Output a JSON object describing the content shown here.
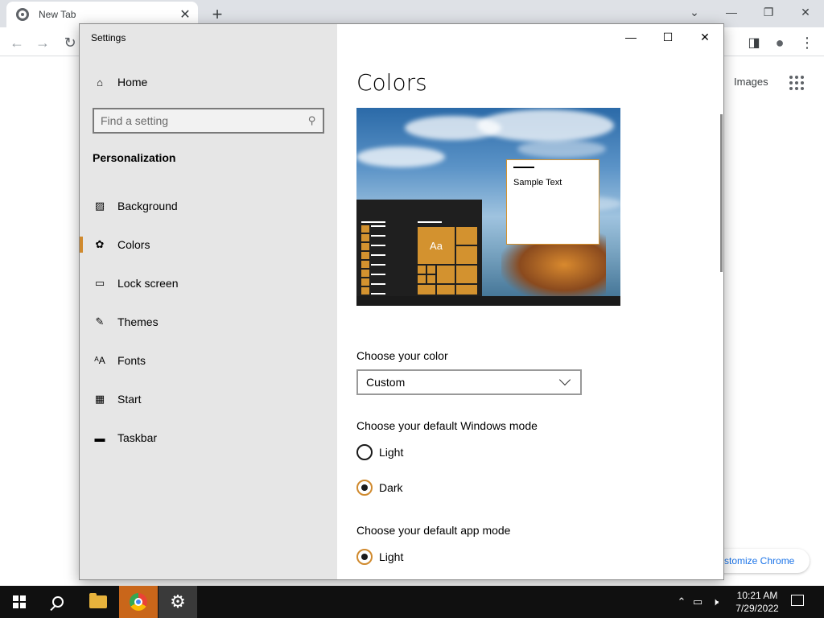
{
  "browser": {
    "tab_title": "New Tab",
    "images_link": "Images",
    "customize_label": "stomize Chrome"
  },
  "settings": {
    "window_title": "Settings",
    "home_label": "Home",
    "search_placeholder": "Find a setting",
    "section_title": "Personalization",
    "nav_items": [
      {
        "label": "Background",
        "icon": "picture-icon"
      },
      {
        "label": "Colors",
        "icon": "palette-icon",
        "active": true
      },
      {
        "label": "Lock screen",
        "icon": "lock-screen-icon"
      },
      {
        "label": "Themes",
        "icon": "brush-icon"
      },
      {
        "label": "Fonts",
        "icon": "font-icon"
      },
      {
        "label": "Start",
        "icon": "start-icon"
      },
      {
        "label": "Taskbar",
        "icon": "taskbar-icon"
      }
    ],
    "page_title": "Colors",
    "preview": {
      "sample_text": "Sample Text",
      "tile_label": "Aa"
    },
    "choose_color_label": "Choose your color",
    "choose_color_value": "Custom",
    "windows_mode_label": "Choose your default Windows mode",
    "windows_mode_options": [
      "Light",
      "Dark"
    ],
    "windows_mode_selected": "Dark",
    "app_mode_label": "Choose your default app mode",
    "app_mode_options": [
      "Light"
    ],
    "app_mode_selected": "Light",
    "accent_color": "#d08a2e"
  },
  "taskbar": {
    "time": "10:21 AM",
    "date": "7/29/2022"
  }
}
